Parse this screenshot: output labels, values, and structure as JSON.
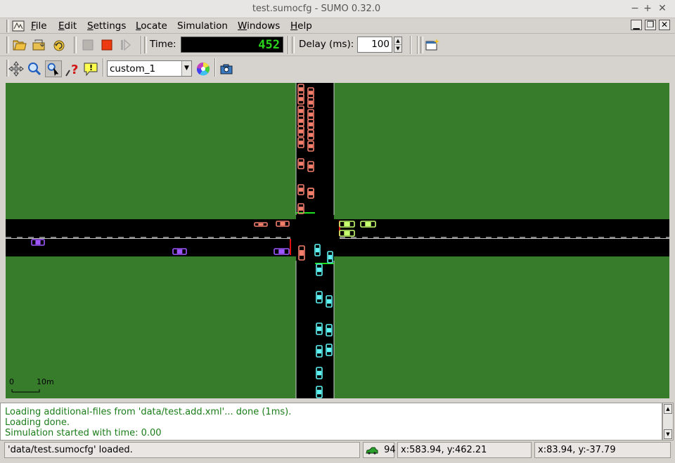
{
  "window": {
    "title": "test.sumocfg - SUMO 0.32.0",
    "min": "−",
    "max": "+",
    "close": "✕"
  },
  "menu": {
    "items": [
      {
        "label": "File",
        "mnemonic": "F",
        "rest": "ile"
      },
      {
        "label": "Edit",
        "mnemonic": "E",
        "rest": "dit"
      },
      {
        "label": "Settings",
        "mnemonic": "S",
        "rest": "ettings"
      },
      {
        "label": "Locate",
        "mnemonic": "L",
        "rest": "ocate"
      },
      {
        "label": "Simulation",
        "mnemonic": "",
        "rest": "Simulation"
      },
      {
        "label": "Windows",
        "mnemonic": "W",
        "rest": "indows"
      },
      {
        "label": "Help",
        "mnemonic": "H",
        "rest": "elp"
      }
    ]
  },
  "toolbar": {
    "time_label": "Time:",
    "time_value": "452",
    "delay_label": "Delay (ms):",
    "delay_value": "100",
    "scheme_value": "custom_1"
  },
  "canvas": {
    "scale_start": "0",
    "scale_end": "10m",
    "colors": {
      "grass": "#367c2b",
      "road": "#000000",
      "north_vehicles": "#f27e6c",
      "east_vehicles": "#c6ff6e",
      "south_vehicles": "#5ef2f2",
      "west_vehicles": "#9e56ff"
    }
  },
  "messages": [
    "Loading additional-files from 'data/test.add.xml'... done (1ms).",
    "Loading done.",
    "Simulation started with time: 0.00"
  ],
  "status": {
    "text": "'data/test.sumocfg' loaded.",
    "vehicle_count": "94",
    "coord1": "x:583.94, y:462.21",
    "coord2": "x:83.94, y:-37.79"
  }
}
